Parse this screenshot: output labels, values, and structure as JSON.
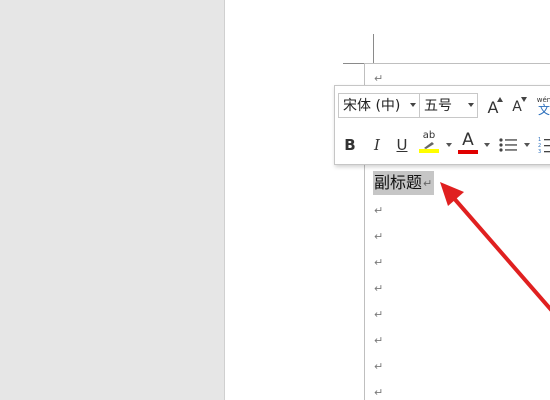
{
  "mini_toolbar": {
    "font_name": "宋体 (中)",
    "font_size": "五号",
    "grow_font_glyph": "A",
    "shrink_font_glyph": "A",
    "phonetic_top": "wén",
    "phonetic_bottom": "文",
    "bold_label": "B",
    "italic_label": "I",
    "underline_label": "U",
    "highlight_label": "ab",
    "font_color_label": "A",
    "highlight_color": "#ffff00",
    "font_color": "#e00000"
  },
  "document": {
    "paragraph_mark": "↵",
    "selected_text": "副标题"
  },
  "annotation": {
    "arrow_color": "#e02020"
  }
}
